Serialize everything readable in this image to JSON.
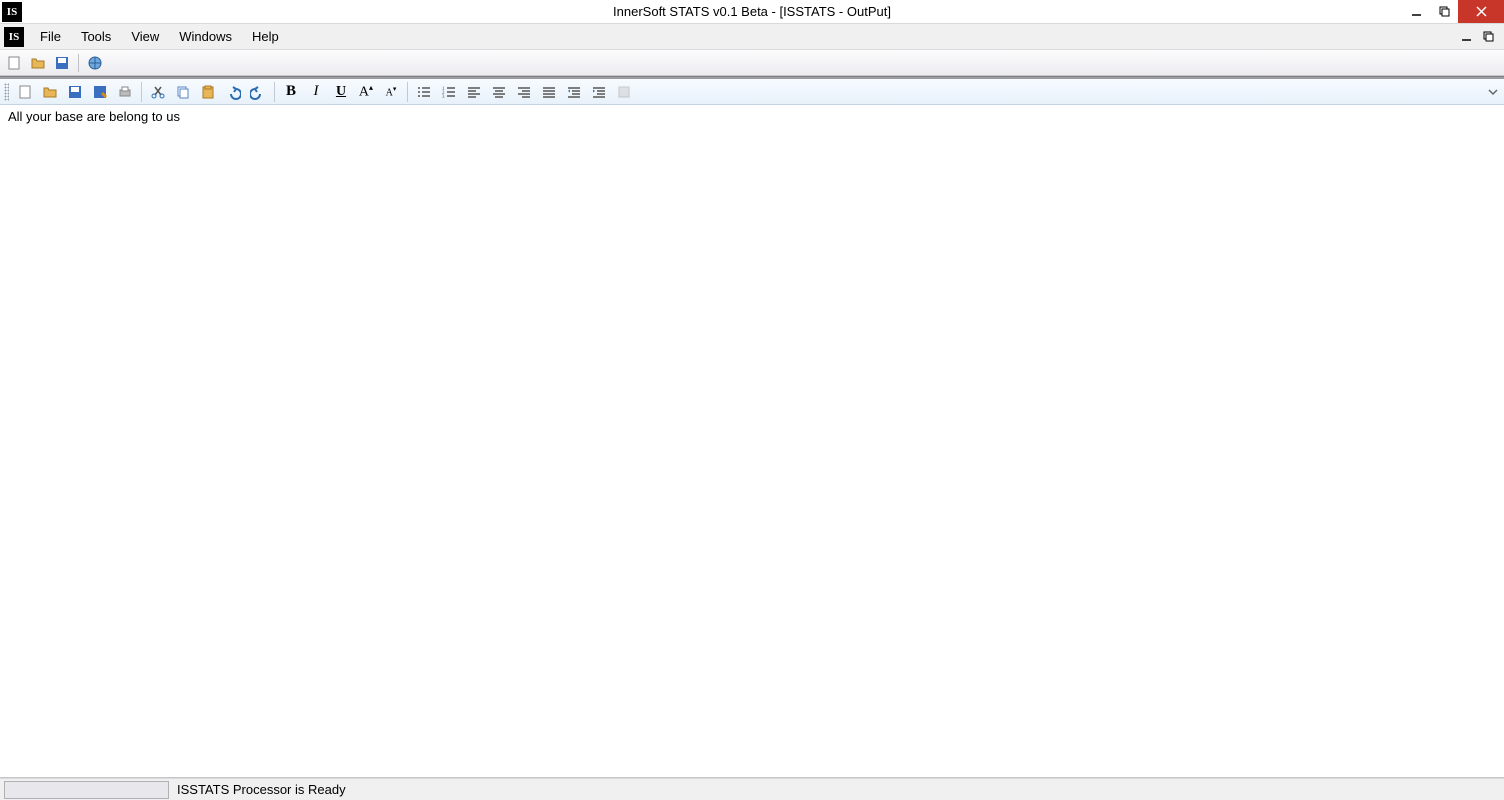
{
  "titlebar": {
    "icon_letter": "IS",
    "title": "InnerSoft STATS v0.1 Beta - [ISSTATS - OutPut]"
  },
  "menubar": {
    "icon_letter": "IS",
    "items": [
      "File",
      "Tools",
      "View",
      "Windows",
      "Help"
    ]
  },
  "content": {
    "text": "All your base are belong to us"
  },
  "statusbar": {
    "text": "ISSTATS Processor is Ready"
  },
  "editor_toolbar": {
    "bold": "B",
    "italic": "I",
    "underline": "U"
  }
}
